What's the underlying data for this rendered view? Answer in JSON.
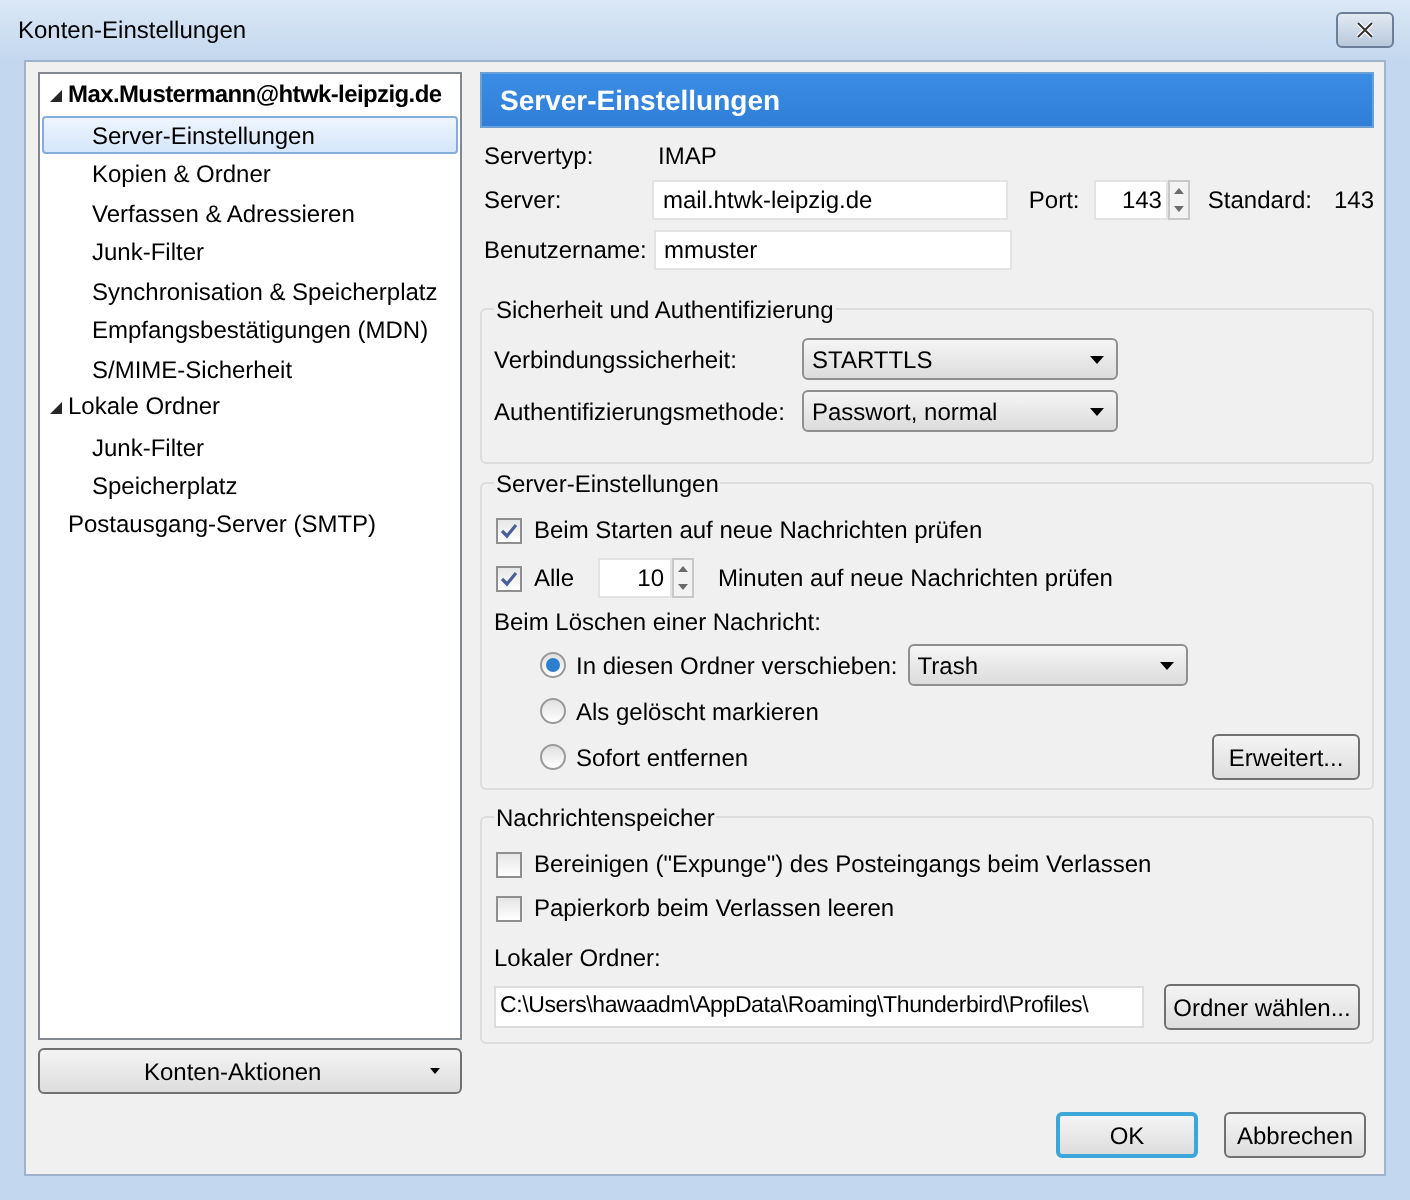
{
  "window": {
    "title": "Konten-Einstellungen"
  },
  "sidebar": {
    "items": [
      {
        "label": "Max.Mustermann@htwk-leipzig.de",
        "kind": "account",
        "expanded": true,
        "selected": false,
        "children": [
          {
            "label": "Server-Einstellungen",
            "selected": true
          },
          {
            "label": "Kopien & Ordner",
            "selected": false
          },
          {
            "label": "Verfassen & Adressieren",
            "selected": false
          },
          {
            "label": "Junk-Filter",
            "selected": false
          },
          {
            "label": "Synchronisation & Speicherplatz",
            "selected": false
          },
          {
            "label": "Empfangsbestätigungen (MDN)",
            "selected": false
          },
          {
            "label": "S/MIME-Sicherheit",
            "selected": false
          }
        ]
      },
      {
        "label": "Lokale Ordner",
        "kind": "folder",
        "expanded": true,
        "selected": false,
        "children": [
          {
            "label": "Junk-Filter",
            "selected": false
          },
          {
            "label": "Speicherplatz",
            "selected": false
          }
        ]
      },
      {
        "label": "Postausgang-Server (SMTP)",
        "kind": "server",
        "selected": false
      }
    ],
    "actions_button": "Konten-Aktionen"
  },
  "panel": {
    "header": "Server-Einstellungen",
    "server_type": {
      "label": "Servertyp:",
      "value": "IMAP"
    },
    "server": {
      "label": "Server:",
      "value": "mail.htwk-leipzig.de"
    },
    "port": {
      "label": "Port:",
      "value": "143"
    },
    "standard": {
      "label": "Standard:",
      "value": "143"
    },
    "username": {
      "label": "Benutzername:",
      "value": "mmuster"
    },
    "security": {
      "title": "Sicherheit und Authentifizierung",
      "rows": [
        {
          "label": "Verbindungssicherheit:",
          "value": "STARTTLS"
        },
        {
          "label": "Authentifizierungsmethode:",
          "value": "Passwort, normal"
        }
      ]
    },
    "server_settings": {
      "title": "Server-Einstellungen",
      "check_on_start": {
        "label": "Beim Starten auf neue Nachrichten prüfen",
        "checked": true
      },
      "check_every": {
        "label": "Alle",
        "checked": true,
        "value": "10",
        "suffix": "Minuten auf neue Nachrichten prüfen"
      },
      "delete_label": "Beim Löschen einer Nachricht:",
      "delete_options": [
        {
          "label": "In diesen Ordner verschieben:",
          "selected": true,
          "folder": "Trash"
        },
        {
          "label": "Als gelöscht markieren",
          "selected": false
        },
        {
          "label": "Sofort entfernen",
          "selected": false
        }
      ],
      "advanced_button": "Erweitert..."
    },
    "storage": {
      "title": "Nachrichtenspeicher",
      "checkboxes": [
        {
          "label": "Bereinigen (\"Expunge\") des Posteingangs beim Verlassen",
          "checked": false
        },
        {
          "label": "Papierkorb beim Verlassen leeren",
          "checked": false
        }
      ],
      "local_folder_label": "Lokaler Ordner:",
      "local_folder": "C:\\Users\\hawaadm\\AppData\\Roaming\\Thunderbird\\Profiles\\",
      "choose_button": "Ordner wählen..."
    }
  },
  "buttons": [
    {
      "label": "OK",
      "focused": true
    },
    {
      "label": "Abbrechen",
      "focused": false
    }
  ]
}
